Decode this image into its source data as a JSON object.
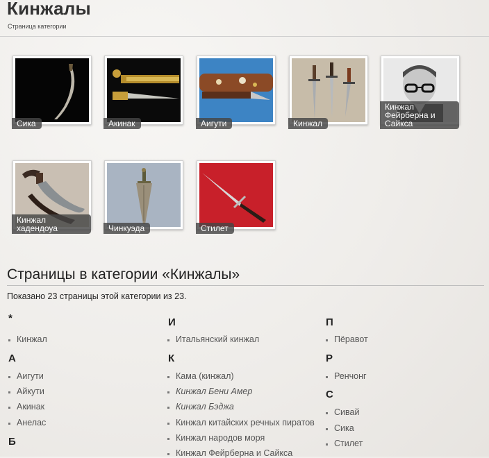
{
  "header": {
    "title": "Кинжалы",
    "subtitle": "Страница категории"
  },
  "gallery": [
    {
      "caption": "Сика",
      "image": "sika-dagger-image"
    },
    {
      "caption": "Акинак",
      "image": "akinak-dagger-image"
    },
    {
      "caption": "Аигути",
      "image": "aiguchi-dagger-image"
    },
    {
      "caption": "Кинжал",
      "image": "daggers-image"
    },
    {
      "caption": "Кинжал Фейрберна и Сайкса",
      "image": "portrait-photo"
    },
    {
      "caption": "Кинжал хадендоуа",
      "image": "hadendoa-dagger-image"
    },
    {
      "caption": "Чинкуэда",
      "image": "cinquedea-image"
    },
    {
      "caption": "Стилет",
      "image": "stiletto-image"
    }
  ],
  "pages": {
    "heading": "Страницы в категории «Кинжалы»",
    "count_text": "Показано 23 страницы этой категории из 23.",
    "columns": [
      {
        "groups": [
          {
            "letter": "*",
            "items": [
              {
                "text": "Кинжал",
                "italic": false
              }
            ]
          },
          {
            "letter": "А",
            "items": [
              {
                "text": "Аигути",
                "italic": false
              },
              {
                "text": "Айкути",
                "italic": false
              },
              {
                "text": "Акинак",
                "italic": false
              },
              {
                "text": "Анелас",
                "italic": false
              }
            ]
          },
          {
            "letter": "Б",
            "items": []
          }
        ]
      },
      {
        "groups": [
          {
            "letter": "И",
            "items": [
              {
                "text": "Итальянский кинжал",
                "italic": false
              }
            ]
          },
          {
            "letter": "К",
            "items": [
              {
                "text": "Кама (кинжал)",
                "italic": false
              },
              {
                "text": "Кинжал Бени Амер",
                "italic": true
              },
              {
                "text": "Кинжал Бэджа",
                "italic": true
              },
              {
                "text": "Кинжал китайских речных пиратов",
                "italic": false
              },
              {
                "text": "Кинжал народов моря",
                "italic": false
              },
              {
                "text": "Кинжал Фейрберна и Сайкса",
                "italic": false
              }
            ]
          }
        ]
      },
      {
        "groups": [
          {
            "letter": "П",
            "items": [
              {
                "text": "Пёравот",
                "italic": false
              }
            ]
          },
          {
            "letter": "Р",
            "items": [
              {
                "text": "Ренчонг",
                "italic": false
              }
            ]
          },
          {
            "letter": "С",
            "items": [
              {
                "text": "Сивай",
                "italic": false
              },
              {
                "text": "Сика",
                "italic": false
              },
              {
                "text": "Стилет",
                "italic": false
              }
            ]
          }
        ]
      }
    ]
  }
}
